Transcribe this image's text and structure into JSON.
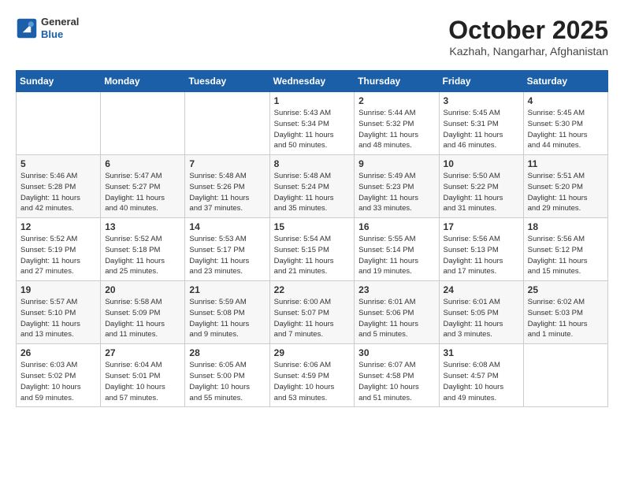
{
  "header": {
    "logo": {
      "general": "General",
      "blue": "Blue"
    },
    "title": "October 2025",
    "location": "Kazhah, Nangarhar, Afghanistan"
  },
  "weekdays": [
    "Sunday",
    "Monday",
    "Tuesday",
    "Wednesday",
    "Thursday",
    "Friday",
    "Saturday"
  ],
  "weeks": [
    [
      {
        "day": "",
        "info": ""
      },
      {
        "day": "",
        "info": ""
      },
      {
        "day": "",
        "info": ""
      },
      {
        "day": "1",
        "info": "Sunrise: 5:43 AM\nSunset: 5:34 PM\nDaylight: 11 hours\nand 50 minutes."
      },
      {
        "day": "2",
        "info": "Sunrise: 5:44 AM\nSunset: 5:32 PM\nDaylight: 11 hours\nand 48 minutes."
      },
      {
        "day": "3",
        "info": "Sunrise: 5:45 AM\nSunset: 5:31 PM\nDaylight: 11 hours\nand 46 minutes."
      },
      {
        "day": "4",
        "info": "Sunrise: 5:45 AM\nSunset: 5:30 PM\nDaylight: 11 hours\nand 44 minutes."
      }
    ],
    [
      {
        "day": "5",
        "info": "Sunrise: 5:46 AM\nSunset: 5:28 PM\nDaylight: 11 hours\nand 42 minutes."
      },
      {
        "day": "6",
        "info": "Sunrise: 5:47 AM\nSunset: 5:27 PM\nDaylight: 11 hours\nand 40 minutes."
      },
      {
        "day": "7",
        "info": "Sunrise: 5:48 AM\nSunset: 5:26 PM\nDaylight: 11 hours\nand 37 minutes."
      },
      {
        "day": "8",
        "info": "Sunrise: 5:48 AM\nSunset: 5:24 PM\nDaylight: 11 hours\nand 35 minutes."
      },
      {
        "day": "9",
        "info": "Sunrise: 5:49 AM\nSunset: 5:23 PM\nDaylight: 11 hours\nand 33 minutes."
      },
      {
        "day": "10",
        "info": "Sunrise: 5:50 AM\nSunset: 5:22 PM\nDaylight: 11 hours\nand 31 minutes."
      },
      {
        "day": "11",
        "info": "Sunrise: 5:51 AM\nSunset: 5:20 PM\nDaylight: 11 hours\nand 29 minutes."
      }
    ],
    [
      {
        "day": "12",
        "info": "Sunrise: 5:52 AM\nSunset: 5:19 PM\nDaylight: 11 hours\nand 27 minutes."
      },
      {
        "day": "13",
        "info": "Sunrise: 5:52 AM\nSunset: 5:18 PM\nDaylight: 11 hours\nand 25 minutes."
      },
      {
        "day": "14",
        "info": "Sunrise: 5:53 AM\nSunset: 5:17 PM\nDaylight: 11 hours\nand 23 minutes."
      },
      {
        "day": "15",
        "info": "Sunrise: 5:54 AM\nSunset: 5:15 PM\nDaylight: 11 hours\nand 21 minutes."
      },
      {
        "day": "16",
        "info": "Sunrise: 5:55 AM\nSunset: 5:14 PM\nDaylight: 11 hours\nand 19 minutes."
      },
      {
        "day": "17",
        "info": "Sunrise: 5:56 AM\nSunset: 5:13 PM\nDaylight: 11 hours\nand 17 minutes."
      },
      {
        "day": "18",
        "info": "Sunrise: 5:56 AM\nSunset: 5:12 PM\nDaylight: 11 hours\nand 15 minutes."
      }
    ],
    [
      {
        "day": "19",
        "info": "Sunrise: 5:57 AM\nSunset: 5:10 PM\nDaylight: 11 hours\nand 13 minutes."
      },
      {
        "day": "20",
        "info": "Sunrise: 5:58 AM\nSunset: 5:09 PM\nDaylight: 11 hours\nand 11 minutes."
      },
      {
        "day": "21",
        "info": "Sunrise: 5:59 AM\nSunset: 5:08 PM\nDaylight: 11 hours\nand 9 minutes."
      },
      {
        "day": "22",
        "info": "Sunrise: 6:00 AM\nSunset: 5:07 PM\nDaylight: 11 hours\nand 7 minutes."
      },
      {
        "day": "23",
        "info": "Sunrise: 6:01 AM\nSunset: 5:06 PM\nDaylight: 11 hours\nand 5 minutes."
      },
      {
        "day": "24",
        "info": "Sunrise: 6:01 AM\nSunset: 5:05 PM\nDaylight: 11 hours\nand 3 minutes."
      },
      {
        "day": "25",
        "info": "Sunrise: 6:02 AM\nSunset: 5:03 PM\nDaylight: 11 hours\nand 1 minute."
      }
    ],
    [
      {
        "day": "26",
        "info": "Sunrise: 6:03 AM\nSunset: 5:02 PM\nDaylight: 10 hours\nand 59 minutes."
      },
      {
        "day": "27",
        "info": "Sunrise: 6:04 AM\nSunset: 5:01 PM\nDaylight: 10 hours\nand 57 minutes."
      },
      {
        "day": "28",
        "info": "Sunrise: 6:05 AM\nSunset: 5:00 PM\nDaylight: 10 hours\nand 55 minutes."
      },
      {
        "day": "29",
        "info": "Sunrise: 6:06 AM\nSunset: 4:59 PM\nDaylight: 10 hours\nand 53 minutes."
      },
      {
        "day": "30",
        "info": "Sunrise: 6:07 AM\nSunset: 4:58 PM\nDaylight: 10 hours\nand 51 minutes."
      },
      {
        "day": "31",
        "info": "Sunrise: 6:08 AM\nSunset: 4:57 PM\nDaylight: 10 hours\nand 49 minutes."
      },
      {
        "day": "",
        "info": ""
      }
    ]
  ]
}
